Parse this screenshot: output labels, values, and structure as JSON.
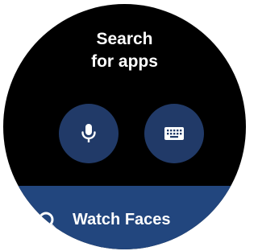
{
  "search": {
    "title_line1": "Search",
    "title_line2": "for apps",
    "voice_icon": "microphone-icon",
    "keyboard_icon": "keyboard-icon"
  },
  "results": [
    {
      "icon": "search-icon",
      "label": "Watch Faces"
    }
  ],
  "colors": {
    "background": "#000000",
    "button_fill": "#213a68",
    "result_fill": "#22467e",
    "text": "#ffffff"
  }
}
